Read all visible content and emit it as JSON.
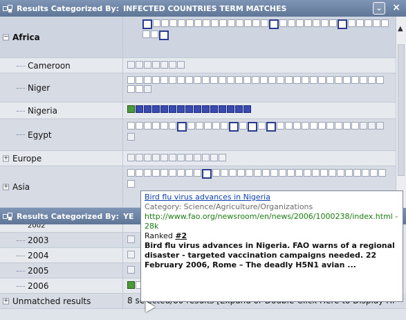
{
  "window1": {
    "title_label": "Results Categorized By:",
    "title_value": "INFECTED COUNTRIES TERM MATCHES",
    "close_label": "×"
  },
  "window2": {
    "title_label": "Results Categorized By:",
    "title_value": "YE"
  },
  "categories": [
    {
      "label": "Africa"
    },
    {
      "label": "Cameroon"
    },
    {
      "label": "Niger"
    },
    {
      "label": "Nigeria"
    },
    {
      "label": "Egypt"
    },
    {
      "label": "Europe"
    },
    {
      "label": "Asia"
    }
  ],
  "years": [
    {
      "label": "2002"
    },
    {
      "label": "2003"
    },
    {
      "label": "2004"
    },
    {
      "label": "2005"
    },
    {
      "label": "2006"
    }
  ],
  "unmatched": {
    "label": "Unmatched results",
    "status": "8 selected/80 results [Expand or Double-Click Here to Display Hi"
  },
  "popup": {
    "title": "Bird flu virus advances in Nigeria",
    "category": "Category: Science/Agriculture/Organizations",
    "url": "http://www.fao.org/newsroom/en/news/2006/1000238/index.html - 28k",
    "ranked_prefix": "Ranked",
    "rank": "#2",
    "body": "Bird flu virus advances in Nigeria. FAO warns of a regional disaster - targeted vaccination campaigns needed. 22 February 2006, Rome – The deadly H5N1 avian ..."
  }
}
